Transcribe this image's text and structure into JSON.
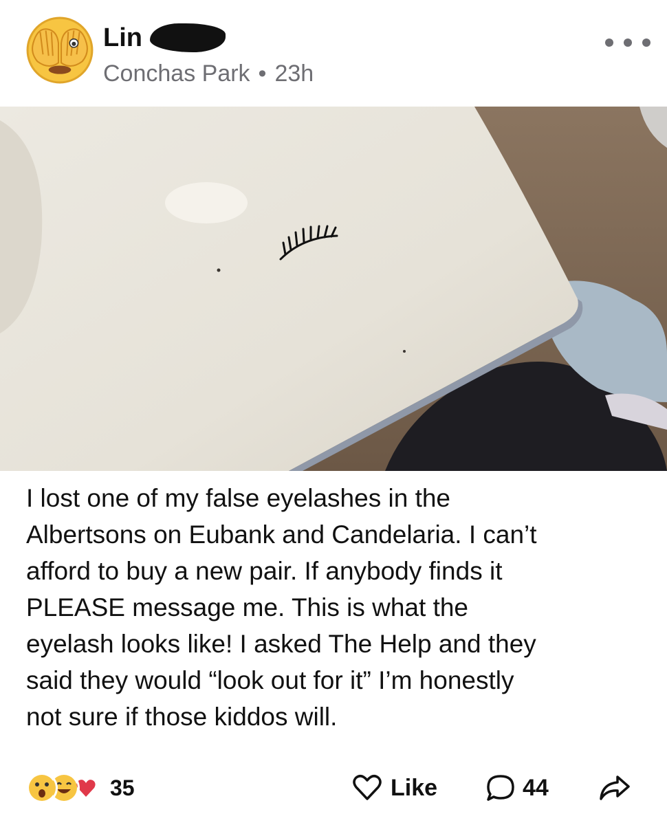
{
  "post": {
    "author_name": "Lin",
    "location": "Conchas Park",
    "separator": "•",
    "time_ago": "23h",
    "caption": "I lost one of my false eyelashes in the\nAlbertsons on Eubank and Candelaria. I can’t\nafford to buy a new pair. If anybody finds it\nPLEASE message me. This is what the\neyelash looks like! I asked The Help and they\nsaid they would “look out for it” I’m honestly\nnot sure if those kiddos will."
  },
  "icons": {
    "avatar": "face-with-hands-over-eyes-emoji",
    "more": "more-options-icon",
    "like": "heart-outline-icon",
    "comment": "comment-bubble-icon",
    "share": "share-arrow-icon"
  },
  "reactions": {
    "emojis": [
      "surprised-emoji",
      "grinning-emoji",
      "heart-emoji"
    ],
    "count": "35"
  },
  "actions": {
    "like_label": "Like",
    "comment_count": "44"
  },
  "colors": {
    "text": "#111111",
    "secondary_text": "#6e6e73",
    "background": "#ffffff"
  }
}
